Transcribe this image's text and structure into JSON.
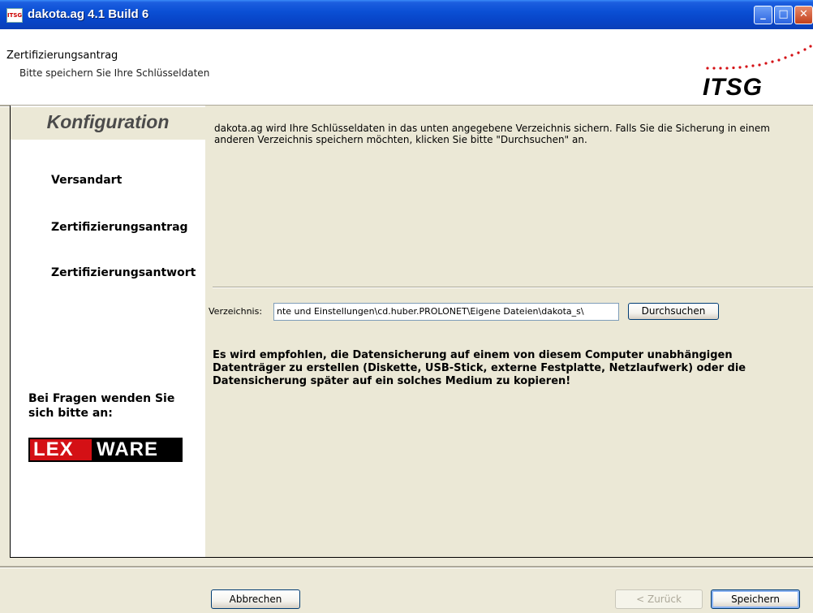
{
  "window": {
    "title": "dakota.ag 4.1 Build 6",
    "app_icon_text": "ITSG",
    "controls": {
      "minimize": "minimize-icon",
      "maximize": "maximize-icon",
      "close": "close-icon"
    }
  },
  "header": {
    "title": "Zertifizierungsantrag",
    "subtitle": "Bitte speichern Sie Ihre Schlüsseldaten",
    "logo_text": "ITSG"
  },
  "sidebar": {
    "heading": "Konfiguration",
    "items": [
      {
        "label": "Versandart"
      },
      {
        "label": "Zertifizierungsantrag"
      },
      {
        "label": "Zertifizierungsantwort"
      }
    ],
    "contact_text": "Bei Fragen wenden Sie sich bitte an:",
    "vendor_logo": {
      "part1": "LEX",
      "part2": "WARE"
    }
  },
  "main": {
    "description": "dakota.ag wird Ihre Schlüsseldaten in das unten angegebene Verzeichnis sichern. Falls Sie die Sicherung in einem anderen Verzeichnis speichern möchten, klicken Sie bitte \"Durchsuchen\" an.",
    "directory_label": "Verzeichnis:",
    "directory_value": "nte und Einstellungen\\cd.huber.PROLONET\\Eigene Dateien\\dakota_s\\",
    "browse_label": "Durchsuchen",
    "warning": "Es wird empfohlen, die Datensicherung auf einem von diesem Computer unabhängigen Datenträger zu erstellen (Diskette, USB-Stick, externe Festplatte, Netzlaufwerk) oder die Datensicherung später auf ein solches Medium zu kopieren!"
  },
  "footer": {
    "cancel_label": "Abbrechen",
    "back_label": "< Zurück",
    "save_label": "Speichern"
  },
  "colors": {
    "titlebar": "#0a4fd4",
    "panel_bg": "#ebe8d6",
    "lex_red": "#d41015"
  }
}
